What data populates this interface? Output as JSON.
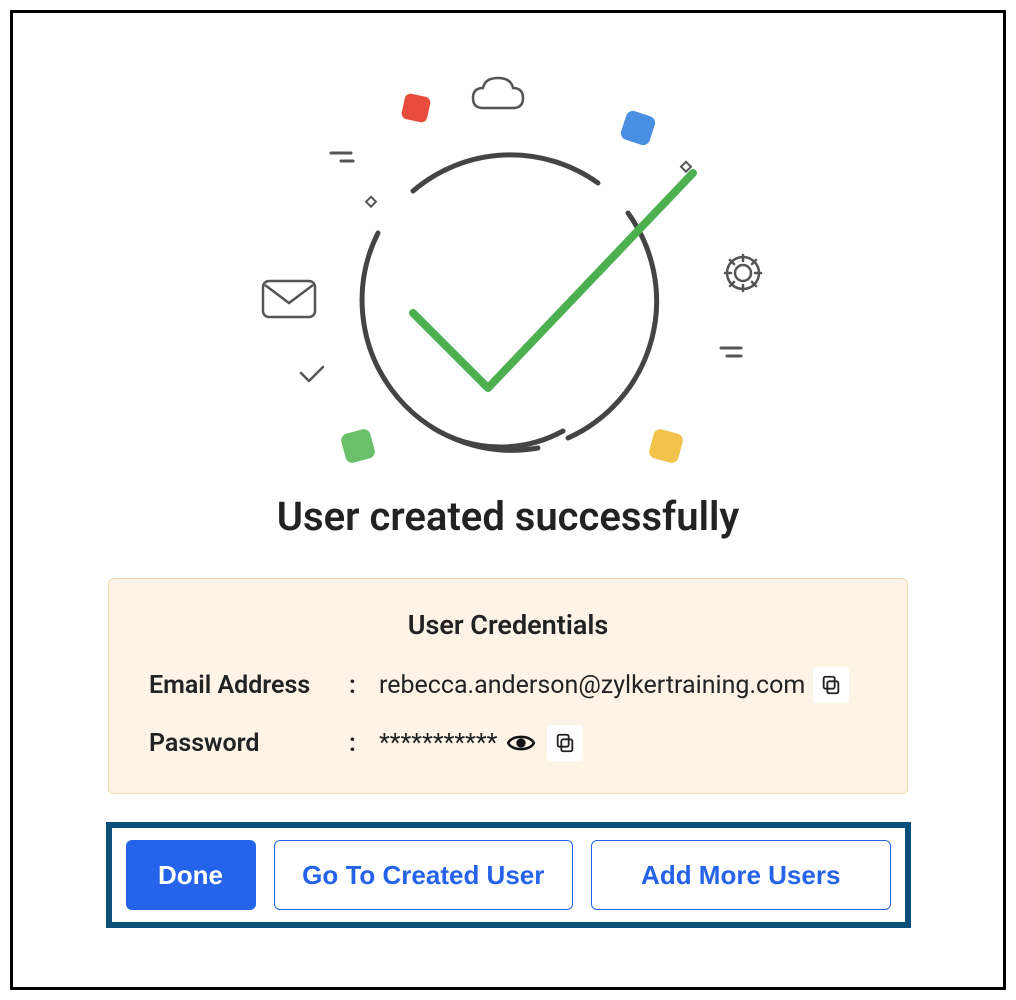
{
  "title": "User created successfully",
  "credentials": {
    "heading": "User Credentials",
    "email_label": "Email Address",
    "email_value": "rebecca.anderson@zylkertraining.com",
    "password_label": "Password",
    "password_value": "***********",
    "colon": ":"
  },
  "buttons": {
    "done": "Done",
    "goto_user": "Go To Created User",
    "add_more": "Add More Users"
  },
  "icons": {
    "copy": "copy-icon",
    "eye": "eye-icon"
  }
}
